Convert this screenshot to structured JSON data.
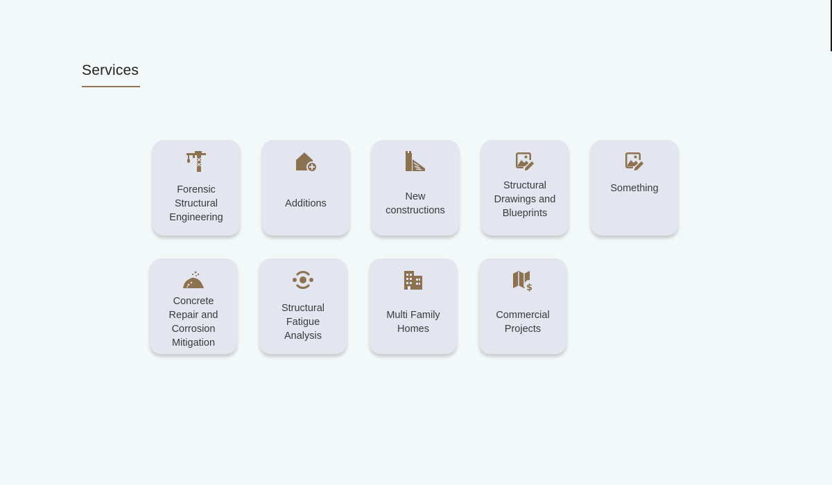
{
  "section": {
    "title": "Services"
  },
  "services": [
    {
      "label": "Forensic Structural Engineering",
      "icon": "tower-crane-icon"
    },
    {
      "label": "Additions",
      "icon": "house-plus-icon"
    },
    {
      "label": "New constructions",
      "icon": "building-under-construction-icon"
    },
    {
      "label": "Structural Drawings and Blueprints",
      "icon": "image-edit-icon"
    },
    {
      "label": "Something",
      "icon": "image-edit-icon"
    },
    {
      "label": "Concrete Repair and Corrosion Mitigation",
      "icon": "concrete-pile-icon"
    },
    {
      "label": "Structural Fatigue Analysis",
      "icon": "circular-orbit-icon"
    },
    {
      "label": "Multi Family Homes",
      "icon": "apartment-building-icon"
    },
    {
      "label": "Commercial Projects",
      "icon": "map-dollar-icon"
    }
  ],
  "colors": {
    "accent": "#8c7250",
    "background": "#f3f8f9",
    "card": "#e3e5ef",
    "text": "#3a3a3a"
  }
}
